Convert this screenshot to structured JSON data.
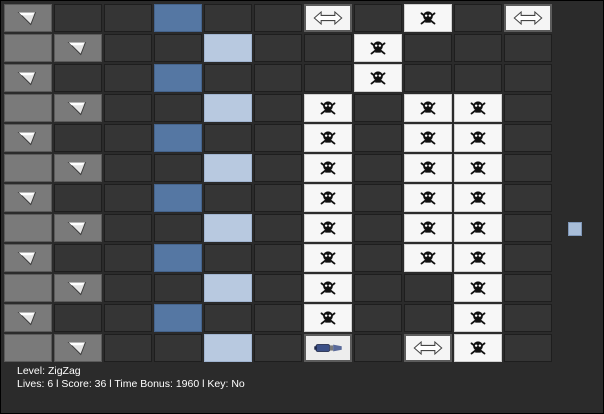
{
  "hud": {
    "level_label": "Level:",
    "level_name": "ZigZag",
    "lives_label": "Lives:",
    "lives": 6,
    "score_label": "Score:",
    "score": 36,
    "time_bonus_label": "Time Bonus:",
    "time_bonus": 1960,
    "key_label": "Key:",
    "key": "No",
    "separator": "l"
  },
  "board": {
    "rows": 12,
    "cols": 11,
    "legend": {
      "E": "empty",
      "G": "gray-block",
      "A": "arrow-block",
      "B": "blue-block",
      "L": "light-blue-block",
      "S": "skull-block",
      "H": "horizontal-mover",
      "P": "paintbrush-block"
    },
    "tiles": [
      "AEEBEEHESEH",
      "GAEELEESEEE",
      "AEEBEEESEEE",
      "GAEELESESSE",
      "AEEBEESESSE",
      "GAEELESESSE",
      "AEEBEESESSE",
      "GAEELESESSE",
      "AEEBEESESSE",
      "GAEELESEESE",
      "AEEBEESEESE",
      "GAEELEPEHSE"
    ],
    "key_item": {
      "row": 7,
      "col": 11,
      "kind": "key-pip"
    }
  },
  "colors": {
    "background": "#2b2b2b",
    "gray_block": "#7a7a7a",
    "blue_block": "#5577a3",
    "light_blue_block": "#b8c9e0",
    "skull_block": "#f7f7f7",
    "hud_text": "#ffffff"
  }
}
